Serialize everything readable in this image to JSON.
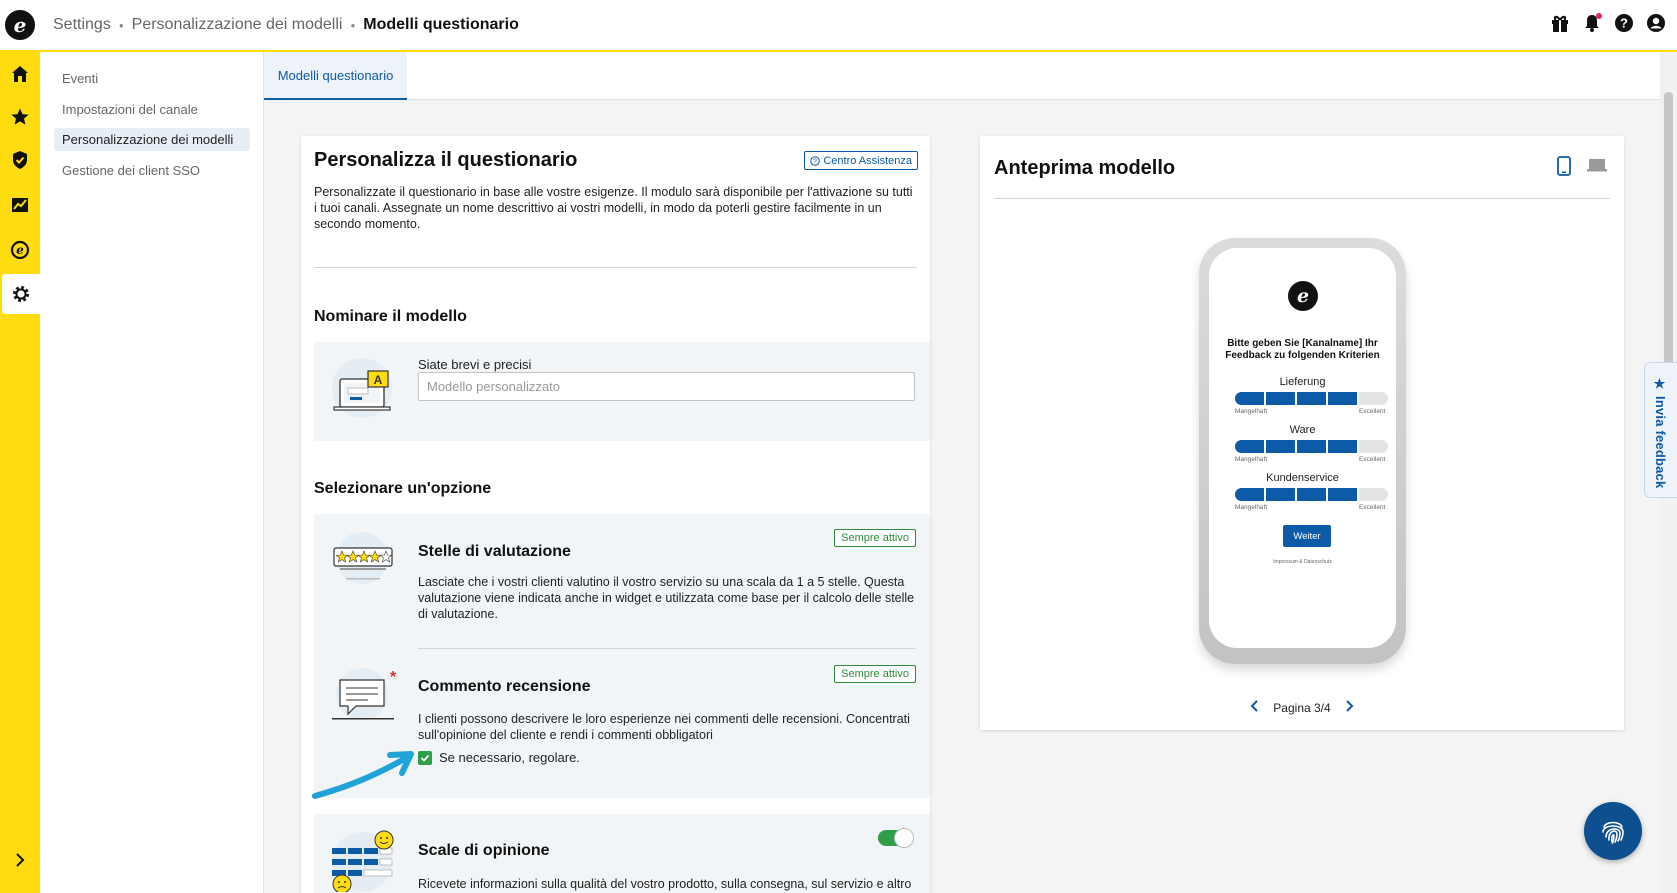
{
  "header": {
    "breadcrumb": [
      "Settings",
      "Personalizzazione dei modelli",
      "Modelli questionario"
    ],
    "icons": [
      "gift-icon",
      "bell-icon",
      "help-icon",
      "account-icon"
    ]
  },
  "rail": {
    "icons": [
      "home-icon",
      "star-icon",
      "shield-icon",
      "analytics-icon",
      "trusted-icon",
      "gear-icon"
    ],
    "expand_icon": "chevron-right-icon"
  },
  "subnav": {
    "items": [
      "Eventi",
      "Impostazioni del canale",
      "Personalizzazione dei modelli",
      "Gestione dei client SSO"
    ],
    "active": "Personalizzazione dei modelli"
  },
  "tabs": [
    "Modelli questionario"
  ],
  "customize": {
    "title": "Personalizza il questionario",
    "help_link": "Centro Assistenza",
    "intro": "Personalizzate il questionario in base alle vostre esigenze. Il modulo sarà disponibile per l'attivazione su tutti i tuoi canali. Assegnate un nome descrittivo ai vostri modelli, in modo da poterli gestire facilmente in un secondo momento.",
    "name_section": {
      "title": "Nominare il modello",
      "label": "Siate brevi e precisi",
      "placeholder": "Modello personalizzato",
      "value": ""
    },
    "options_title": "Selezionare un'opzione",
    "options": [
      {
        "title": "Stelle di valutazione",
        "badge": "Sempre attivo",
        "description": "Lasciate che i vostri clienti valutino il vostro servizio su una scala da 1 a 5 stelle. Questa valutazione viene indicata anche in widget e utilizzata come base per il calcolo delle stelle di valutazione."
      },
      {
        "title": "Commento recensione",
        "badge": "Sempre attivo",
        "description": "I clienti possono descrivere le loro esperienze nei commenti delle recensioni. Concentrati sull'opinione del cliente e rendi i commenti obbligatori",
        "checkbox_label": "Se necessario, regolare.",
        "checkbox_checked": true
      },
      {
        "title": "Scale di opinione",
        "toggle_on": true,
        "description": "Ricevete informazioni sulla qualità del vostro prodotto, sulla consegna, sul servizio e altro"
      }
    ]
  },
  "preview": {
    "title": "Anteprima modello",
    "device_icons": [
      "mobile-icon",
      "desktop-icon"
    ],
    "phone": {
      "heading": "Bitte geben Sie [Kanalname] Ihr Feedback zu folgenden Kriterien",
      "criteria": [
        {
          "name": "Lieferung",
          "rating": 4,
          "max": 5
        },
        {
          "name": "Ware",
          "rating": 4,
          "max": 5
        },
        {
          "name": "Kundenservice",
          "rating": 4,
          "max": 5
        }
      ],
      "scale_low": "Mangelhaft",
      "scale_high": "Excellent",
      "button": "Weiter",
      "footer": "Impressum & Datenschutz"
    },
    "pager": "Pagina 3/4"
  },
  "feedback_tab": "Invia feedback",
  "colors": {
    "brand_yellow": "#ffdc0f",
    "primary_blue": "#0d5aa7",
    "success_green": "#2e9e48",
    "annotation_arrow": "#1fa3d8"
  }
}
